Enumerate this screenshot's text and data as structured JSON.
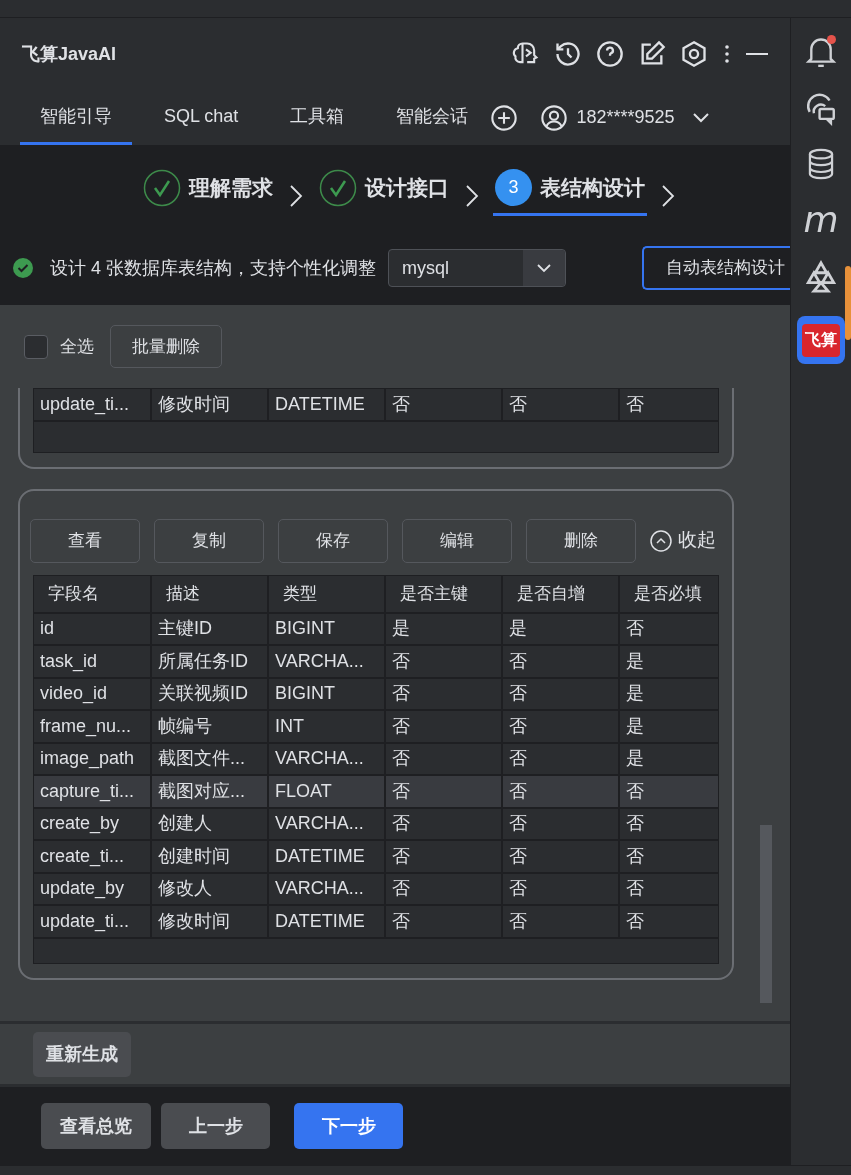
{
  "app": {
    "title": "飞算JavaAI"
  },
  "tabs": [
    {
      "label": "智能引导",
      "selected": true
    },
    {
      "label": "SQL chat",
      "selected": false
    },
    {
      "label": "工具箱",
      "selected": false
    },
    {
      "label": "智能会话",
      "selected": false
    }
  ],
  "account": {
    "label": "182****9525"
  },
  "steps": [
    {
      "label": "理解需求",
      "kind": "done",
      "selected": false
    },
    {
      "label": "设计接口",
      "kind": "done",
      "selected": false
    },
    {
      "label": "表结构设计",
      "kind": "current",
      "number": "3",
      "selected": true
    }
  ],
  "info": {
    "text": "设计 4 张数据库表结构，支持个性化调整"
  },
  "database_select": {
    "value": "mysql"
  },
  "auto_design_button": {
    "label": "自动表结构设计"
  },
  "select_all": {
    "label": "全选",
    "checked": false
  },
  "batch_delete": {
    "label": "批量删除"
  },
  "tables": [
    {
      "rows": [
        {
          "cells": [
            "update_ti...",
            "修改时间",
            "DATETIME",
            "否",
            "否",
            "否"
          ],
          "selected": false
        }
      ]
    },
    {
      "actions": [
        "查看",
        "复制",
        "保存",
        "编辑",
        "删除"
      ],
      "collapse_label": "收起",
      "columns": [
        "字段名",
        "描述",
        "类型",
        "是否主键",
        "是否自增",
        "是否必填"
      ],
      "rows": [
        {
          "cells": [
            "id",
            "主键ID",
            "BIGINT",
            "是",
            "是",
            "否"
          ],
          "selected": false
        },
        {
          "cells": [
            "task_id",
            "所属任务ID",
            "VARCHA...",
            "否",
            "否",
            "是"
          ],
          "selected": false
        },
        {
          "cells": [
            "video_id",
            "关联视频ID",
            "BIGINT",
            "否",
            "否",
            "是"
          ],
          "selected": false
        },
        {
          "cells": [
            "frame_nu...",
            "帧编号",
            "INT",
            "否",
            "否",
            "是"
          ],
          "selected": false
        },
        {
          "cells": [
            "image_path",
            "截图文件...",
            "VARCHA...",
            "否",
            "否",
            "是"
          ],
          "selected": false
        },
        {
          "cells": [
            "capture_ti...",
            "截图对应...",
            "FLOAT",
            "否",
            "否",
            "否"
          ],
          "selected": true
        },
        {
          "cells": [
            "create_by",
            "创建人",
            "VARCHA...",
            "否",
            "否",
            "否"
          ],
          "selected": false
        },
        {
          "cells": [
            "create_ti...",
            "创建时间",
            "DATETIME",
            "否",
            "否",
            "否"
          ],
          "selected": false
        },
        {
          "cells": [
            "update_by",
            "修改人",
            "VARCHA...",
            "否",
            "否",
            "否"
          ],
          "selected": false
        },
        {
          "cells": [
            "update_ti...",
            "修改时间",
            "DATETIME",
            "否",
            "否",
            "否"
          ],
          "selected": false
        }
      ]
    }
  ],
  "regenerate_button": {
    "label": "重新生成"
  },
  "footer_buttons": [
    {
      "label": "查看总览",
      "kind": "secondary"
    },
    {
      "label": "上一步",
      "kind": "secondary"
    },
    {
      "label": "下一步",
      "kind": "primary"
    }
  ],
  "sidebar": {
    "notification_unread": true,
    "plugin_label": "m",
    "logo_text": "飞算"
  }
}
